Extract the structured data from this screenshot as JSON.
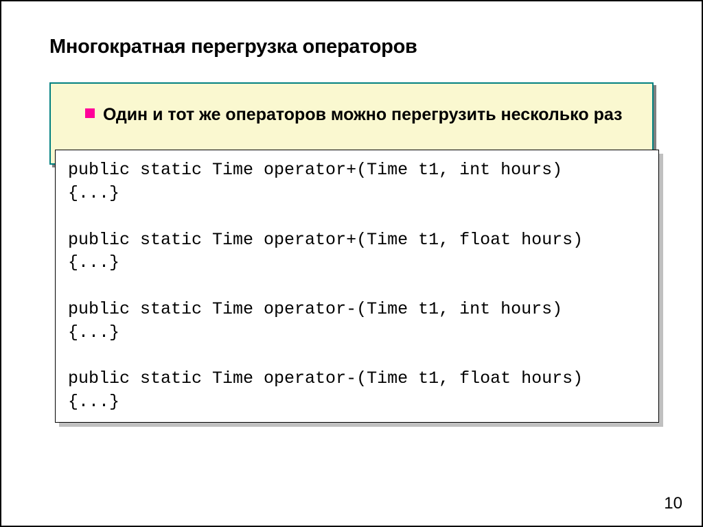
{
  "slide": {
    "title": "Многократная перегрузка операторов",
    "bullet_text": "Один и тот же операторов можно перегрузить несколько раз",
    "code": "public static Time operator+(Time t1, int hours)\n{...}\n\npublic static Time operator+(Time t1, float hours)\n{...}\n\npublic static Time operator-(Time t1, int hours)\n{...}\n\npublic static Time operator-(Time t1, float hours)\n{...}",
    "page_number": "10"
  }
}
